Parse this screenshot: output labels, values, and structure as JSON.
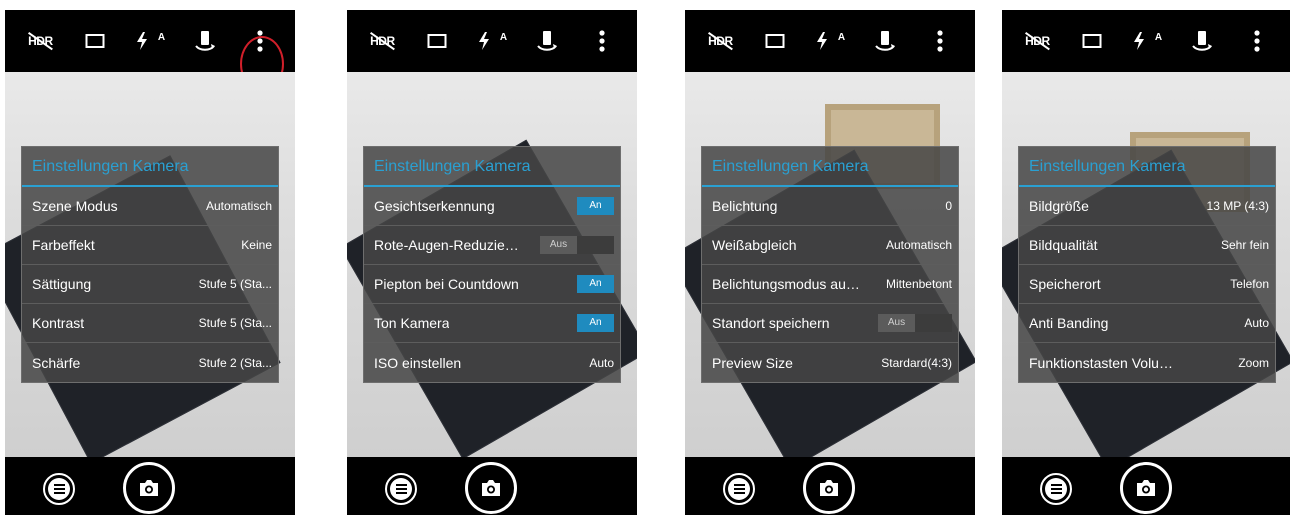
{
  "screens": [
    {
      "title": "Einstellungen Kamera",
      "highlighted_control": "overflow-menu",
      "rows": [
        {
          "label": "Szene Modus",
          "value": "Automatisch"
        },
        {
          "label": "Farbeffekt",
          "value": "Keine"
        },
        {
          "label": "Sättigung",
          "value": "Stufe 5 (Sta..."
        },
        {
          "label": "Kontrast",
          "value": "Stufe 5 (Sta..."
        },
        {
          "label": "Schärfe",
          "value": "Stufe 2 (Sta..."
        }
      ]
    },
    {
      "title": "Einstellungen Kamera",
      "rows": [
        {
          "label": "Gesichtserkennung",
          "toggle": "on",
          "on_label": "An",
          "off_label": ""
        },
        {
          "label": "Rote-Augen-Reduzieru...",
          "toggle": "off",
          "on_label": "",
          "off_label": "Aus"
        },
        {
          "label": "Piepton bei Countdown",
          "toggle": "on",
          "on_label": "An",
          "off_label": ""
        },
        {
          "label": "Ton Kamera",
          "toggle": "on",
          "on_label": "An",
          "off_label": ""
        },
        {
          "label": "ISO einstellen",
          "value": "Auto"
        }
      ]
    },
    {
      "title": "Einstellungen Kamera",
      "rows": [
        {
          "label": "Belichtung",
          "value": "0"
        },
        {
          "label": "Weißabgleich",
          "value": "Automatisch"
        },
        {
          "label": "Belichtungsmodus aus...",
          "value": "Mittenbetont"
        },
        {
          "label": "Standort speichern",
          "toggle": "off",
          "on_label": "",
          "off_label": "Aus"
        },
        {
          "label": "Preview Size",
          "value": "Stardard(4:3)"
        }
      ]
    },
    {
      "title": "Einstellungen Kamera",
      "rows": [
        {
          "label": "Bildgröße",
          "value": "13 MP (4:3)"
        },
        {
          "label": "Bildqualität",
          "value": "Sehr fein"
        },
        {
          "label": "Speicherort",
          "value": "Telefon"
        },
        {
          "label": "Anti Banding",
          "value": "Auto"
        },
        {
          "label": "Funktionstasten Volum...",
          "value": "Zoom"
        }
      ]
    }
  ],
  "top_icons": [
    "hdr-off-icon",
    "aspect-ratio-icon",
    "flash-auto-icon",
    "switch-camera-icon",
    "overflow-menu-icon"
  ],
  "top_labels": {
    "hdr": "HDR",
    "flash_auto": "A"
  },
  "bottom_icons": [
    "menu-icon",
    "camera-shutter-icon"
  ],
  "colors": {
    "accent": "#2aa0d2",
    "toggle_on": "#1f8bbf",
    "highlight": "#d11f2a"
  }
}
